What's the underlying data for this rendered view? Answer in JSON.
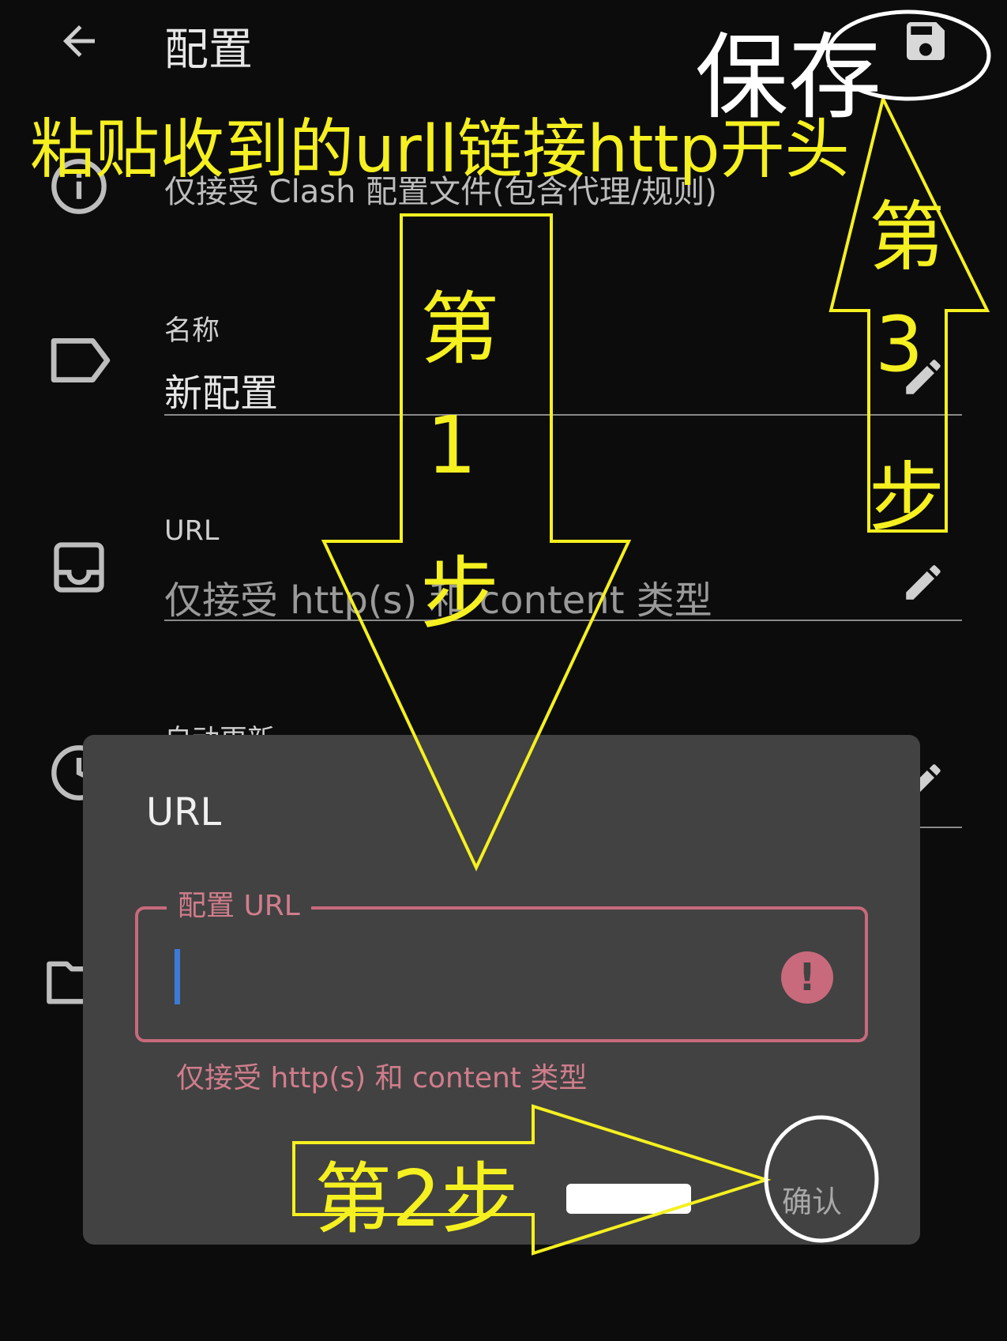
{
  "app_bar": {
    "title": "配置"
  },
  "info": {
    "text": "仅接受 Clash 配置文件(包含代理/规则)"
  },
  "name_field": {
    "label": "名称",
    "value": "新配置"
  },
  "url_field": {
    "label": "URL",
    "placeholder": "仅接受 http(s) 和 content 类型"
  },
  "auto_update": {
    "label": "自动更新"
  },
  "dialog": {
    "title": "URL",
    "field_label": "配置 URL",
    "helper": "仅接受 http(s) 和 content 类型",
    "confirm_label": "确认"
  },
  "annotations": {
    "headline": "粘贴收到的urll链接http开头",
    "save_note": "保存",
    "step1": [
      "第",
      "1",
      "步"
    ],
    "step2": "第2步",
    "step3": [
      "第",
      "3",
      "步"
    ]
  },
  "colors": {
    "background": "#0c0c0c",
    "dialog": "#424242",
    "error": "#c86a7c",
    "annotation": "#f5f020",
    "caret": "#3b7bd6"
  }
}
